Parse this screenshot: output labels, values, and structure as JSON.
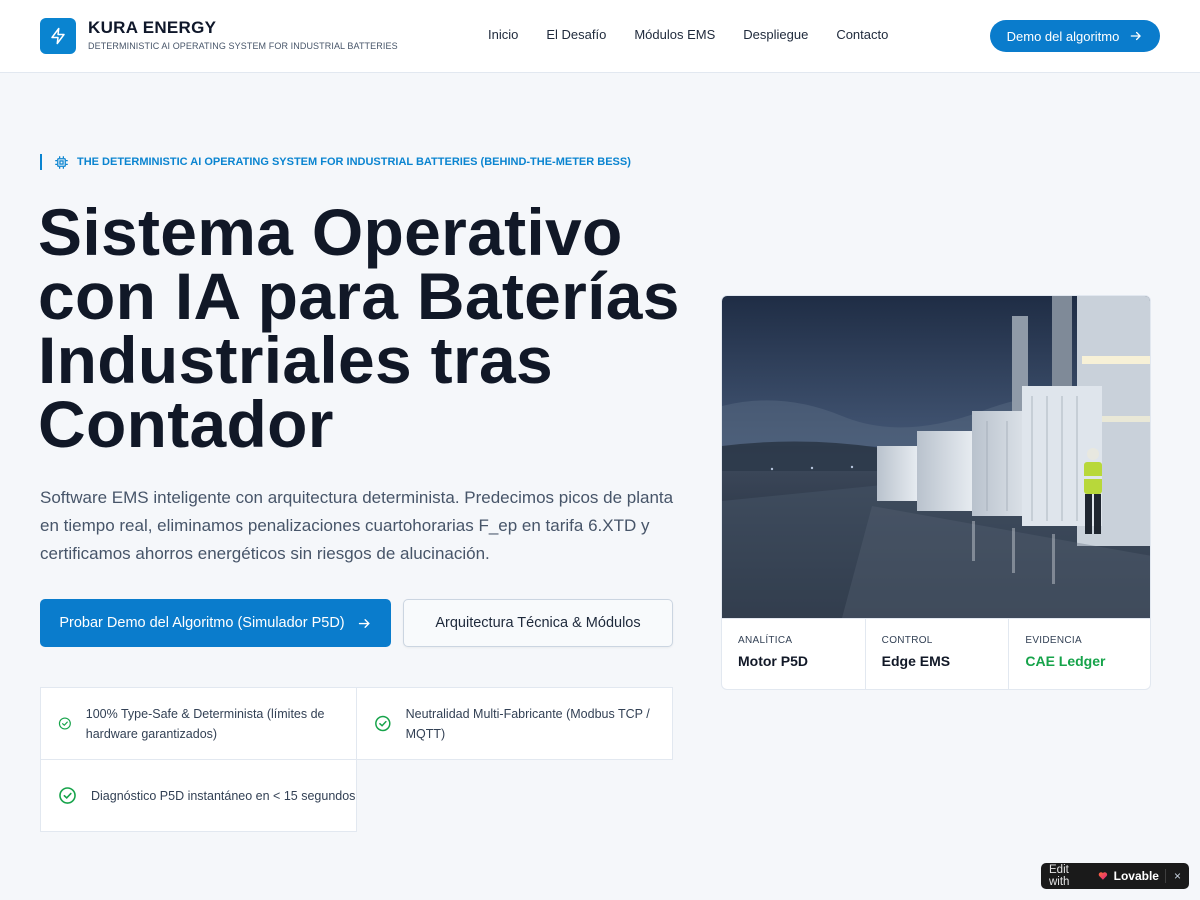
{
  "header": {
    "brand_name": "KURA ENERGY",
    "brand_tagline": "DETERMINISTIC AI OPERATING SYSTEM FOR INDUSTRIAL BATTERIES",
    "logo_icon": "lightning-bolt-icon",
    "nav": [
      "Inicio",
      "El Desafío",
      "Módulos EMS",
      "Despliegue",
      "Contacto"
    ],
    "cta_label": "Demo del algoritmo"
  },
  "hero": {
    "eyebrow": "THE DETERMINISTIC AI OPERATING SYSTEM FOR INDUSTRIAL BATTERIES (BEHIND-THE-METER BESS)",
    "title": "Sistema Operativo con IA para Baterías Industriales tras Contador",
    "subtitle": "Software EMS inteligente con arquitectura determinista. Predecimos picos de planta en tiempo real, eliminamos penalizaciones cuartohorarias F_ep en tarifa 6.XTD y certificamos ahorros energéticos sin riesgos de alucinación.",
    "primary_button": "Probar Demo del Algoritmo (Simulador P5D)",
    "secondary_button": "Arquitectura Técnica & Módulos"
  },
  "features": [
    "100% Type-Safe & Determinista (límites de hardware garantizados)",
    "Neutralidad Multi-Fabricante (Modbus TCP / MQTT)",
    "Diagnóstico P5D instantáneo en < 15 segundos"
  ],
  "card": {
    "stats": [
      {
        "label": "ANALÍTICA",
        "value": "Motor P5D"
      },
      {
        "label": "CONTROL",
        "value": "Edge EMS"
      },
      {
        "label": "EVIDENCIA",
        "value": "CAE Ledger"
      }
    ]
  },
  "badge": {
    "prefix": "Edit with",
    "brand": "Lovable",
    "close": "×"
  },
  "colors": {
    "accent": "#0a7ccc",
    "success": "#16a34a",
    "heading": "#111827",
    "background": "#f5f7fa"
  }
}
